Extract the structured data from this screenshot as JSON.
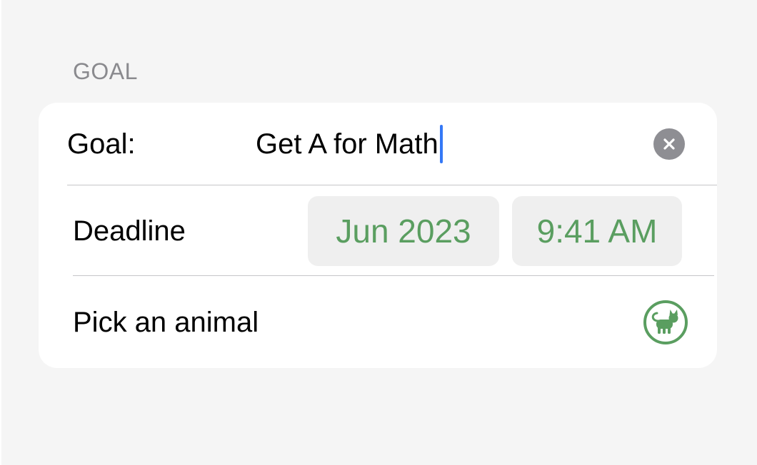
{
  "section": {
    "header": "GOAL"
  },
  "goal": {
    "label": "Goal:",
    "value": "Get A for Math",
    "clear_icon": "xmark-circle-fill-icon"
  },
  "deadline": {
    "label": "Deadline",
    "date": "Jun 2023",
    "time": "9:41 AM"
  },
  "animal": {
    "label": "Pick an animal",
    "icon": "cat-circle-icon"
  },
  "colors": {
    "accent": "#5a9e60",
    "caret": "#3478f6",
    "clear_button": "#8e8e93",
    "section_header": "#8a8a8e",
    "background": "#f5f5f5",
    "pill_background": "#efefef"
  }
}
